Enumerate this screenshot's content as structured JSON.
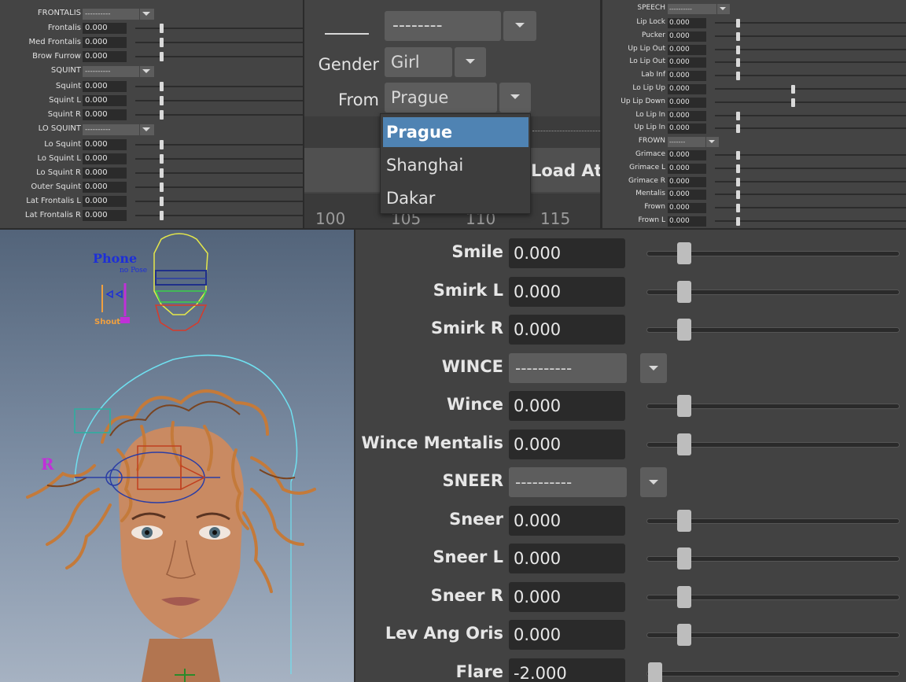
{
  "frontalis_panel": {
    "header_label": "FRONTALIS",
    "header_value": "----------",
    "rows": [
      {
        "label": "Frontalis",
        "value": "0.000"
      },
      {
        "label": "Med Frontalis",
        "value": "0.000"
      },
      {
        "label": "Brow Furrow",
        "value": "0.000"
      }
    ],
    "squint_header": "SQUINT",
    "squint_value": "----------",
    "squint_rows": [
      {
        "label": "Squint",
        "value": "0.000"
      },
      {
        "label": "Squint L",
        "value": "0.000"
      },
      {
        "label": "Squint R",
        "value": "0.000"
      }
    ],
    "losquint_header": "LO SQUINT",
    "losquint_value": "----------",
    "losquint_rows": [
      {
        "label": "Lo Squint",
        "value": "0.000"
      },
      {
        "label": "Lo Squint L",
        "value": "0.000"
      },
      {
        "label": "Lo Squint R",
        "value": "0.000"
      },
      {
        "label": "Outer Squint",
        "value": "0.000"
      },
      {
        "label": "Lat Frontalis L",
        "value": "0.000"
      },
      {
        "label": "Lat Frontalis R",
        "value": "0.000"
      }
    ]
  },
  "character_panel": {
    "top_dropdown_value": "--------",
    "gender_label": "Gender",
    "gender_value": "Girl",
    "from_label": "From",
    "from_value": "Prague",
    "from_options": [
      "Prague",
      "Shanghai",
      "Dakar"
    ],
    "load_button": "Load At",
    "timeline_ticks": [
      "100",
      "105",
      "110",
      "115"
    ]
  },
  "speech_panel": {
    "header_label": "SPEECH",
    "header_value": "----------",
    "rows": [
      {
        "label": "Lip Lock",
        "value": "0.000",
        "level": 0.0
      },
      {
        "label": "Pucker",
        "value": "0.000",
        "level": 0.0
      },
      {
        "label": "Up Lip Out",
        "value": "0.000",
        "level": 0.0
      },
      {
        "label": "Lo Lip Out",
        "value": "0.000",
        "level": 0.0
      },
      {
        "label": "Lab Inf",
        "value": "0.000",
        "level": 0.0
      },
      {
        "label": "Lo Lip Up",
        "value": "0.000",
        "level": 0.5
      },
      {
        "label": "Up Lip Down",
        "value": "0.000",
        "level": 0.5
      },
      {
        "label": "Lo Lip In",
        "value": "0.000",
        "level": 0.0
      },
      {
        "label": "Up Lip In",
        "value": "0.000",
        "level": 0.0
      }
    ],
    "frown_header": "FROWN",
    "frown_value": "-------",
    "frown_rows": [
      {
        "label": "Grimace",
        "value": "0.000",
        "level": 0.0
      },
      {
        "label": "Grimace L",
        "value": "0.000",
        "level": 0.0
      },
      {
        "label": "Grimace R",
        "value": "0.000",
        "level": 0.0
      },
      {
        "label": "Mentalis",
        "value": "0.000",
        "level": 0.0
      },
      {
        "label": "Frown",
        "value": "0.000",
        "level": 0.0
      },
      {
        "label": "Frown L",
        "value": "0.000",
        "level": 0.0
      }
    ]
  },
  "viewport": {
    "phone_label": "Phone",
    "no_pose_label": "no Pose",
    "shout_label": "Shout",
    "r_label": "R"
  },
  "mouth_panel": {
    "rows": [
      {
        "label": "Smile",
        "value": "0.000"
      },
      {
        "label": "Smirk L",
        "value": "0.000"
      },
      {
        "label": "Smirk R",
        "value": "0.000"
      }
    ],
    "wince_header": "WINCE",
    "wince_value": "----------",
    "wince_rows": [
      {
        "label": "Wince",
        "value": "0.000"
      },
      {
        "label": "Wince Mentalis",
        "value": "0.000"
      }
    ],
    "sneer_header": "SNEER",
    "sneer_value": "----------",
    "sneer_rows": [
      {
        "label": "Sneer",
        "value": "0.000"
      },
      {
        "label": "Sneer L",
        "value": "0.000"
      },
      {
        "label": "Sneer R",
        "value": "0.000"
      },
      {
        "label": "Lev Ang Oris",
        "value": "0.000"
      },
      {
        "label": "Flare",
        "value": "-2.000"
      }
    ]
  },
  "colors": {
    "panel_bg": "#444444",
    "field_bg": "#2b2b2b",
    "dropdown_highlight": "#4f83b3",
    "viewport_bg": "#7f90a6"
  }
}
